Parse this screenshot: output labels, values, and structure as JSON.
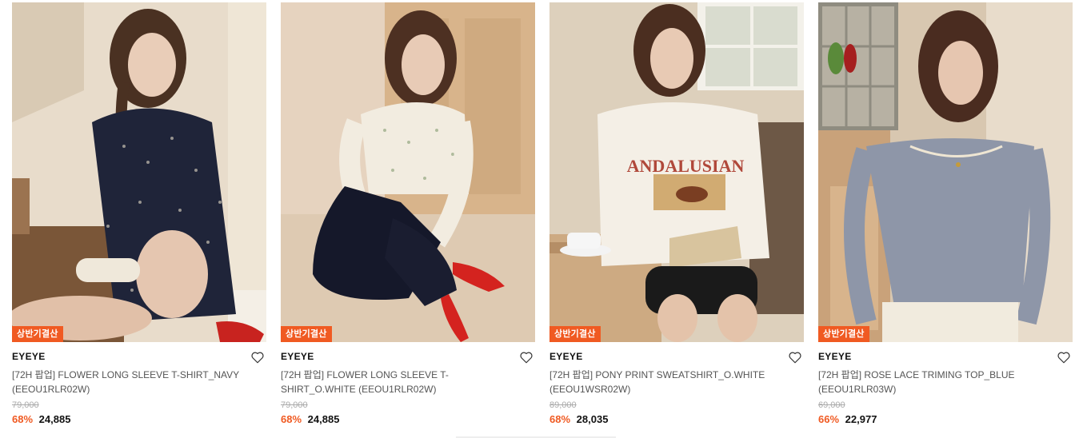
{
  "products": [
    {
      "badge": "상반기결산",
      "brand": "EYEYE",
      "name": "[72H 팝업] FLOWER LONG SLEEVE T-SHIRT_NAVY (EEOU1RLR02W)",
      "original_price": "79,000",
      "discount": "68%",
      "price": "24,885"
    },
    {
      "badge": "상반기결산",
      "brand": "EYEYE",
      "name": "[72H 팝업] FLOWER LONG SLEEVE T-SHIRT_O.WHITE (EEOU1RLR02W)",
      "original_price": "79,000",
      "discount": "68%",
      "price": "24,885"
    },
    {
      "badge": "상반기결산",
      "brand": "EYEYE",
      "name": "[72H 팝업] PONY PRINT SWEATSHIRT_O.WHITE (EEOU1WSR02W)",
      "original_price": "89,000",
      "discount": "68%",
      "price": "28,035"
    },
    {
      "badge": "상반기결산",
      "brand": "EYEYE",
      "name": "[72H 팝업] ROSE LACE TRIMING TOP_BLUE (EEOU1RLR03W)",
      "original_price": "69,000",
      "discount": "66%",
      "price": "22,977"
    }
  ],
  "print_text": {
    "andalusian": "ANDALUSIAN"
  },
  "colors": {
    "badge": "#f05a22",
    "discount": "#f05a22"
  }
}
